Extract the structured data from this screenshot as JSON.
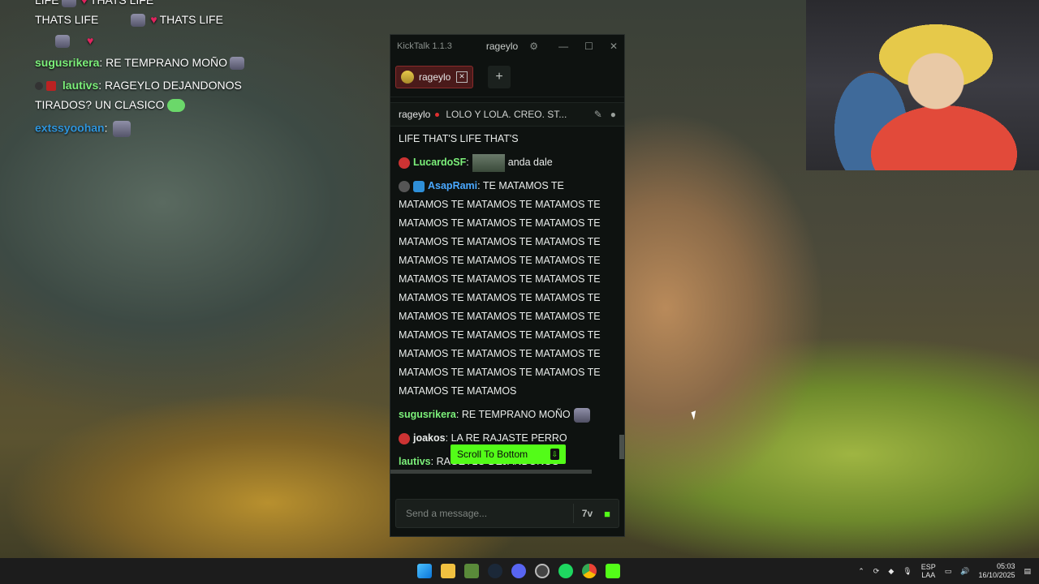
{
  "overlay_chat": {
    "line1_text": "LIFE",
    "line1_text2": "THATS LIFE",
    "line2_text": "THATS LIFE",
    "line2_text2": "THATS LIFE",
    "messages": [
      {
        "user": "sugusrikera",
        "color": "#7cf07a",
        "text": "RE TEMPRANO MOÑO"
      },
      {
        "user": "lautivs",
        "color": "#7cf07a",
        "text": "RAGEYLO DEJANDONOS"
      },
      {
        "text": "TIRADOS? UN CLASICO"
      },
      {
        "user": "extssyoohan",
        "color": "#2f95dc",
        "text": ""
      }
    ]
  },
  "kicktalk": {
    "app_title": "KickTalk 1.1.3",
    "window_user": "rageylo",
    "tab_label": "rageylo",
    "add_tab": "+",
    "channel_name": "rageylo",
    "stream_title": "LOLO Y LOLA. CREO. ST...",
    "chat": [
      {
        "user": "",
        "color": "#e9ecea",
        "text": "LIFE THAT'S LIFE THAT'S"
      },
      {
        "user": "LucardoSF",
        "color": "#7cf07a",
        "text": "anda dale"
      },
      {
        "user": "AsapRami",
        "color": "#4aa8ff",
        "text": "TE MATAMOS TE MATAMOS TE MATAMOS TE MATAMOS TE MATAMOS TE MATAMOS TE MATAMOS TE MATAMOS TE MATAMOS TE MATAMOS TE MATAMOS TE MATAMOS TE MATAMOS TE MATAMOS TE MATAMOS TE MATAMOS TE MATAMOS TE MATAMOS TE MATAMOS TE MATAMOS TE MATAMOS TE MATAMOS TE MATAMOS TE MATAMOS TE MATAMOS TE MATAMOS TE MATAMOS TE MATAMOS TE MATAMOS TE MATAMOS TE MATAMOS TE MATAMOS TE MATAMOS"
      },
      {
        "user": "sugusrikera",
        "color": "#7cf07a",
        "text": "RE TEMPRANO MOÑO"
      },
      {
        "user": "joakos",
        "color": "#e9ecea",
        "text": "LA RE RAJASTE PERRO"
      },
      {
        "user": "lautivs",
        "color": "#7cf07a",
        "text": "RAGEYLO DEJANDONOS"
      }
    ],
    "scroll_to_bottom": "Scroll To Bottom",
    "input_placeholder": "Send a message...",
    "accent": "#53fc18"
  },
  "taskbar": {
    "lang_top": "ESP",
    "lang_bottom": "LAA",
    "time": "05:03",
    "date": "16/10/2025",
    "apps": [
      "windows-start",
      "file-explorer",
      "minecraft",
      "steam",
      "discord",
      "obs",
      "spotify",
      "chrome",
      "kick"
    ]
  }
}
